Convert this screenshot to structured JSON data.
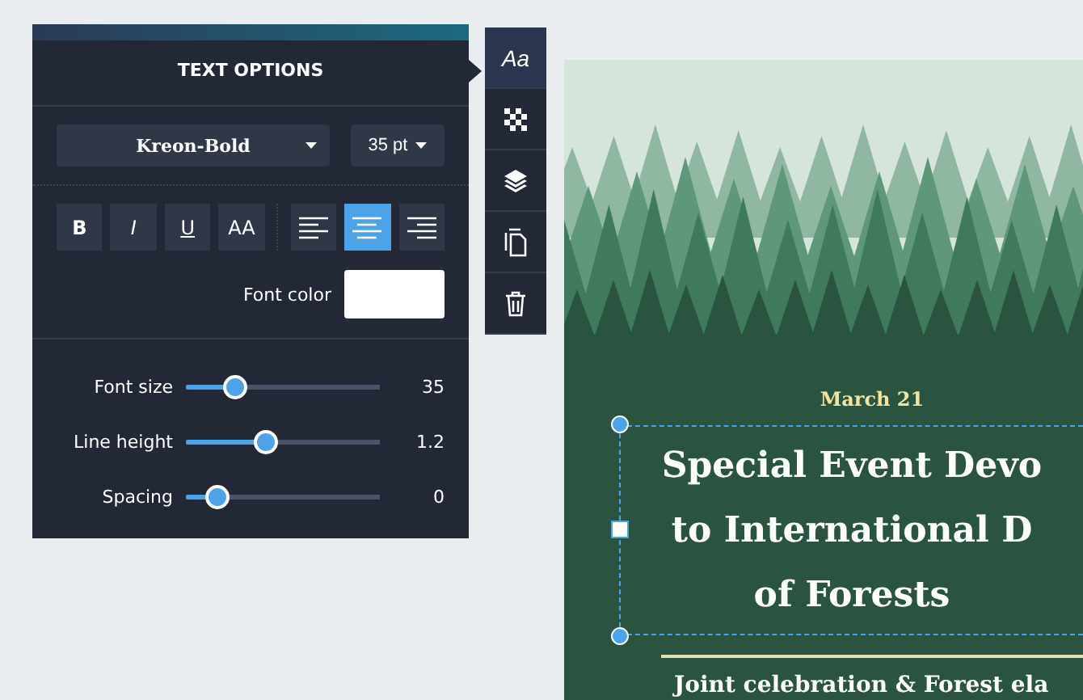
{
  "panel": {
    "title": "TEXT OPTIONS",
    "font": {
      "value": "Kreon-Bold"
    },
    "size": {
      "value": "35 pt"
    },
    "style_buttons": [
      {
        "label": "B",
        "kind": "bold",
        "selected": false
      },
      {
        "label": "I",
        "kind": "italic",
        "selected": false
      },
      {
        "label": "U",
        "kind": "underline",
        "selected": false
      },
      {
        "label": "AA",
        "kind": "caps",
        "selected": false
      }
    ],
    "align_buttons": [
      {
        "kind": "left",
        "selected": false
      },
      {
        "kind": "center",
        "selected": true
      },
      {
        "kind": "right",
        "selected": false
      }
    ],
    "font_color": {
      "label": "Font color",
      "color": "#ffffff"
    },
    "sliders": [
      {
        "label": "Font size",
        "level": 0.25,
        "reading": "35"
      },
      {
        "label": "Line height",
        "level": 0.41,
        "reading": "1.2"
      },
      {
        "label": "Spacing",
        "level": 0.16,
        "reading": "0"
      }
    ]
  },
  "toolbar": [
    {
      "kind": "text",
      "label": "Aa",
      "selected": true
    },
    {
      "kind": "transparency",
      "selected": false
    },
    {
      "kind": "layers",
      "selected": false
    },
    {
      "kind": "duplicate",
      "selected": false
    },
    {
      "kind": "delete",
      "selected": false
    }
  ],
  "poster": {
    "date": "March 21",
    "headline": [
      "Special Event Devo",
      "to International D",
      "of Forests"
    ],
    "subtitle": "Joint celebration & Forest ela"
  }
}
